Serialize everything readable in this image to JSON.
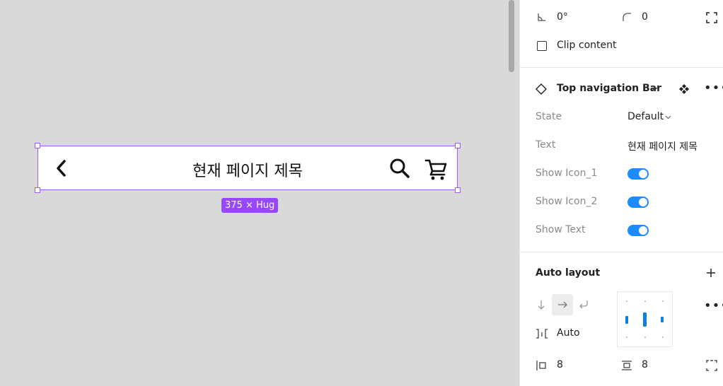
{
  "canvas": {
    "nav_bar": {
      "title": "현재 페이지 제목"
    },
    "size_badge": "375 × Hug"
  },
  "panel": {
    "rotation": "0°",
    "corner_radius": "0",
    "clip_content": "Clip content",
    "component": {
      "name": "Top navigation Bar",
      "props": [
        {
          "label": "State",
          "value": "Default"
        },
        {
          "label": "Text",
          "value": "현재 페이지 제목"
        },
        {
          "label": "Show Icon_1",
          "value": true
        },
        {
          "label": "Show Icon_2",
          "value": true
        },
        {
          "label": "Show Text",
          "value": true
        }
      ]
    },
    "auto_layout": {
      "title": "Auto layout",
      "gap": "Auto",
      "padding_horizontal": "8",
      "padding_vertical": "8"
    }
  },
  "colors": {
    "selection": "#a05cf5",
    "badge": "#9747ff",
    "toggle": "#1a8cff",
    "accent": "#0d7de8"
  }
}
